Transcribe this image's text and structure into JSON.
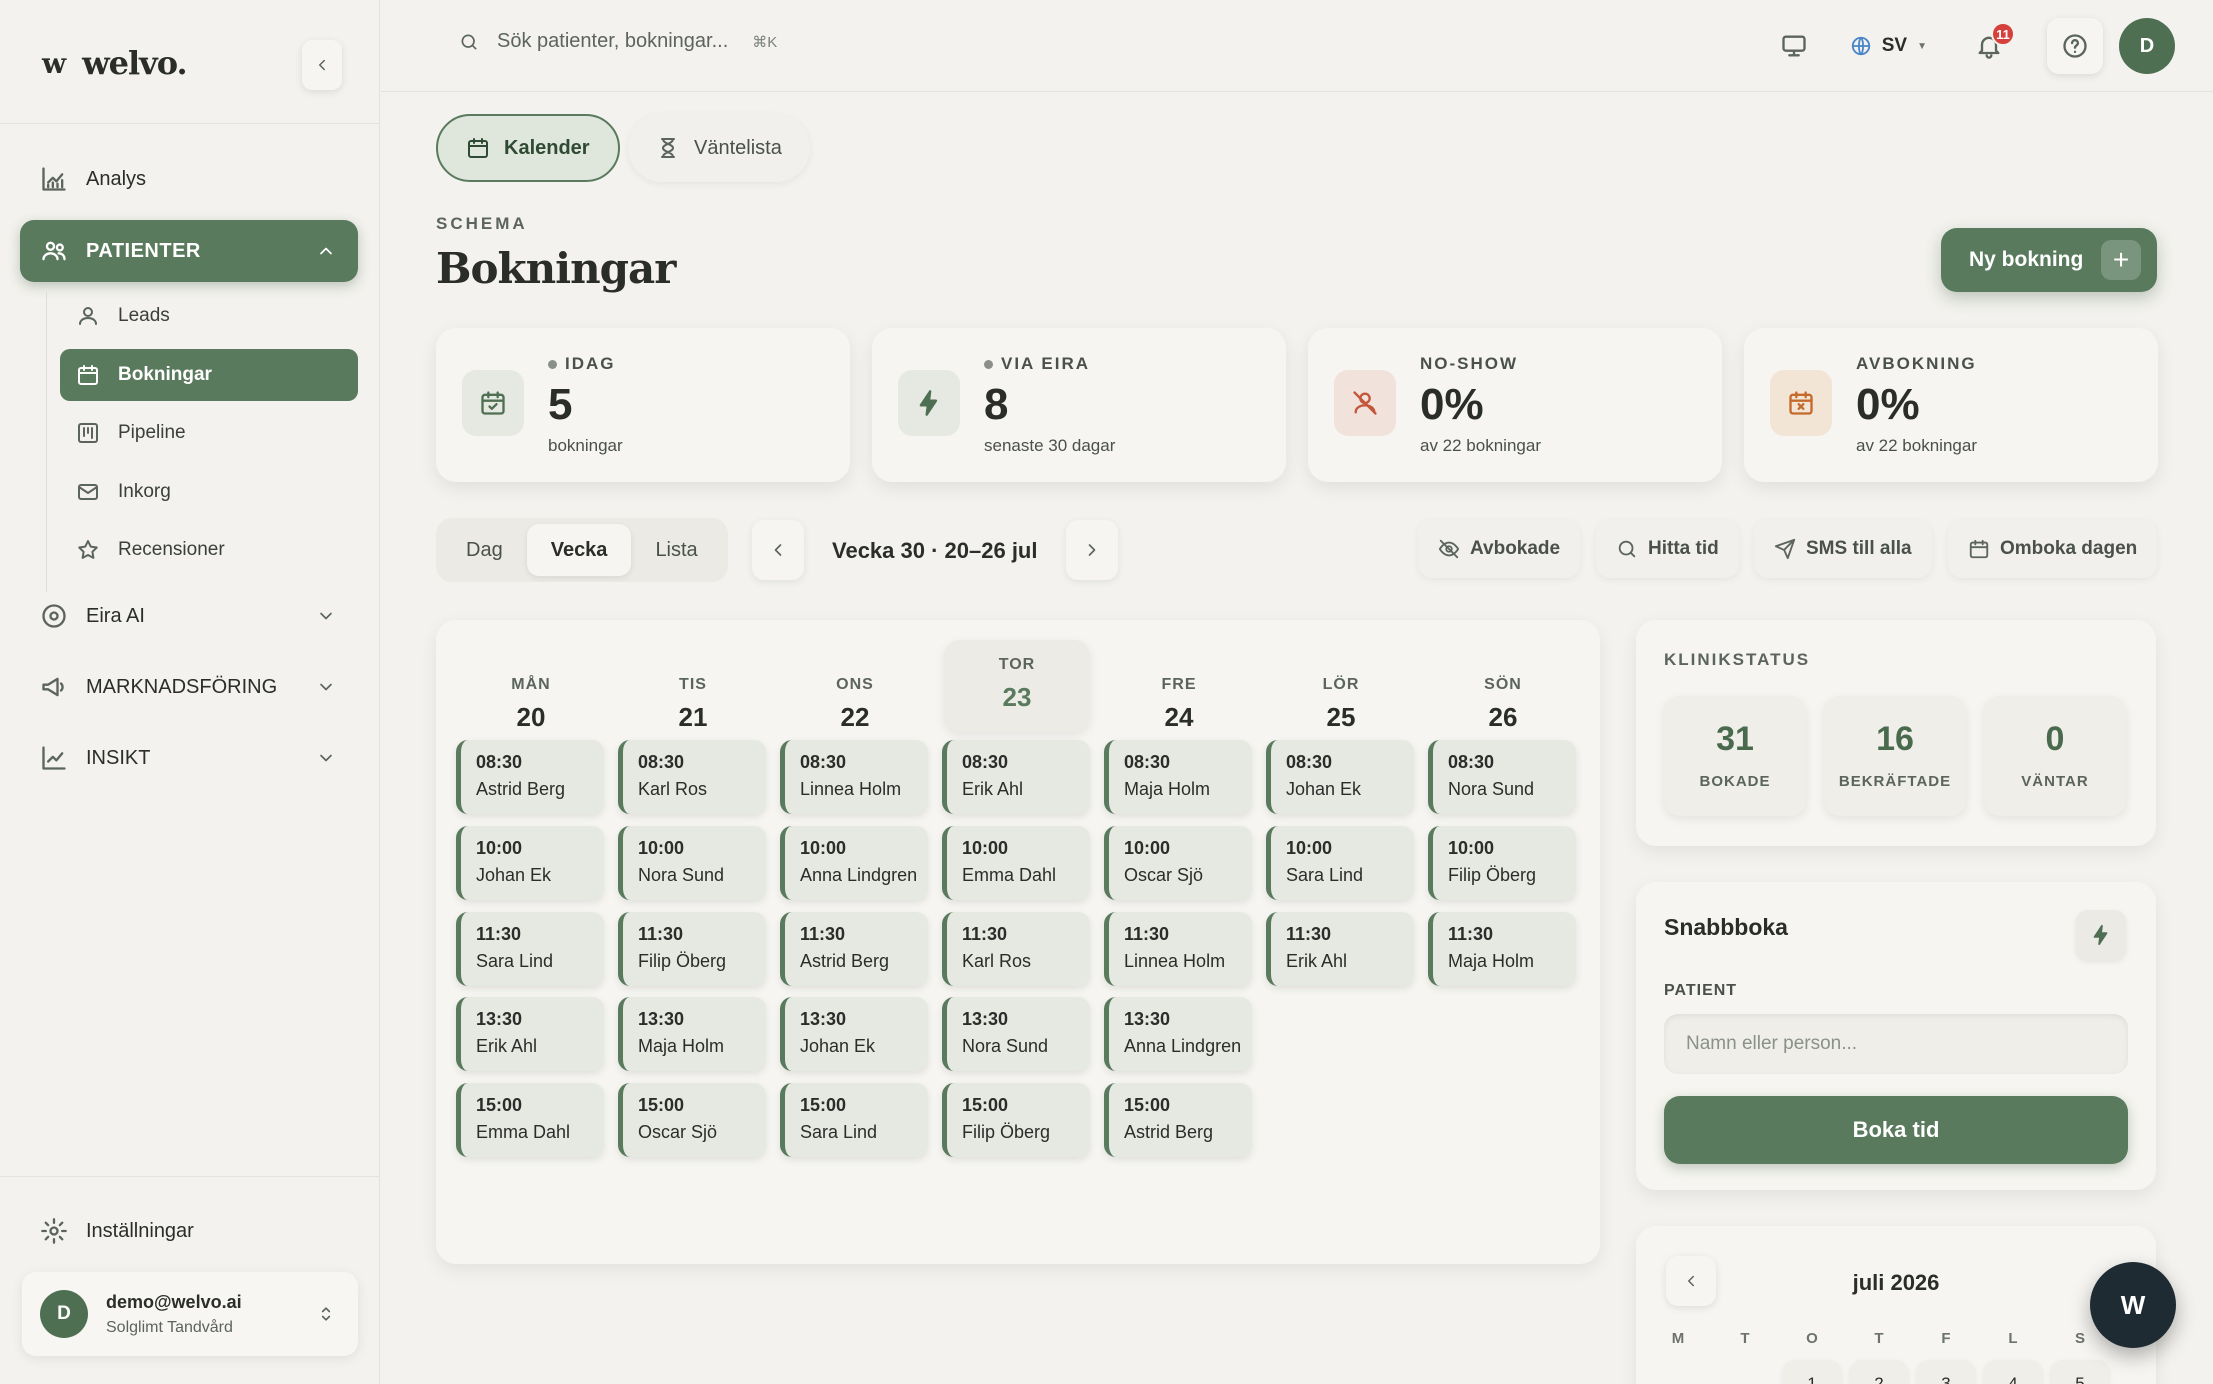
{
  "brand": {
    "mark": "w",
    "name": "welvo."
  },
  "sidebar": {
    "analys": "Analys",
    "patienter": "PATIENTER",
    "sub": [
      "Leads",
      "Bokningar",
      "Pipeline",
      "Inkorg",
      "Recensioner"
    ],
    "eira": "Eira AI",
    "marknad": "MARKNADSFÖRING",
    "insikt": "INSIKT",
    "settings": "Inställningar",
    "user": {
      "initial": "D",
      "email": "demo@welvo.ai",
      "clinic": "Solglimt Tandvård"
    }
  },
  "topbar": {
    "search_placeholder": "Sök patienter, bokningar...",
    "shortcut": "⌘K",
    "lang": "SV",
    "notif_count": "11",
    "avatar": "D"
  },
  "tabs": {
    "kalender": "Kalender",
    "vantelista": "Väntelista"
  },
  "header": {
    "eyebrow": "SCHEMA",
    "title": "Bokningar",
    "new_booking": "Ny bokning",
    "plus": "+"
  },
  "stats": [
    {
      "label": "IDAG",
      "value": "5",
      "sub": "bokningar"
    },
    {
      "label": "VIA EIRA",
      "value": "8",
      "sub": "senaste 30 dagar"
    },
    {
      "label": "NO-SHOW",
      "value": "0%",
      "sub": "av 22 bokningar"
    },
    {
      "label": "AVBOKNING",
      "value": "0%",
      "sub": "av 22 bokningar"
    }
  ],
  "toolbar": {
    "views": [
      "Dag",
      "Vecka",
      "Lista"
    ],
    "week": "Vecka 30 · 20–26 jul",
    "avbokade": "Avbokade",
    "hitta": "Hitta tid",
    "sms": "SMS till alla",
    "omboka": "Omboka dagen"
  },
  "days": [
    {
      "name": "MÅN",
      "date": "20",
      "bookings": [
        {
          "time": "08:30",
          "name": "Astrid Berg"
        },
        {
          "time": "10:00",
          "name": "Johan Ek"
        },
        {
          "time": "11:30",
          "name": "Sara Lind"
        },
        {
          "time": "13:30",
          "name": "Erik Ahl"
        },
        {
          "time": "15:00",
          "name": "Emma Dahl"
        }
      ]
    },
    {
      "name": "TIS",
      "date": "21",
      "bookings": [
        {
          "time": "08:30",
          "name": "Karl Ros"
        },
        {
          "time": "10:00",
          "name": "Nora Sund"
        },
        {
          "time": "11:30",
          "name": "Filip Öberg"
        },
        {
          "time": "13:30",
          "name": "Maja Holm"
        },
        {
          "time": "15:00",
          "name": "Oscar Sjö"
        }
      ]
    },
    {
      "name": "ONS",
      "date": "22",
      "bookings": [
        {
          "time": "08:30",
          "name": "Linnea Holm"
        },
        {
          "time": "10:00",
          "name": "Anna Lindgren"
        },
        {
          "time": "11:30",
          "name": "Astrid Berg"
        },
        {
          "time": "13:30",
          "name": "Johan Ek"
        },
        {
          "time": "15:00",
          "name": "Sara Lind"
        }
      ]
    },
    {
      "name": "TOR",
      "date": "23",
      "today": true,
      "bookings": [
        {
          "time": "08:30",
          "name": "Erik Ahl"
        },
        {
          "time": "10:00",
          "name": "Emma Dahl"
        },
        {
          "time": "11:30",
          "name": "Karl Ros"
        },
        {
          "time": "13:30",
          "name": "Nora Sund"
        },
        {
          "time": "15:00",
          "name": "Filip Öberg"
        }
      ]
    },
    {
      "name": "FRE",
      "date": "24",
      "bookings": [
        {
          "time": "08:30",
          "name": "Maja Holm"
        },
        {
          "time": "10:00",
          "name": "Oscar Sjö"
        },
        {
          "time": "11:30",
          "name": "Linnea Holm"
        },
        {
          "time": "13:30",
          "name": "Anna Lindgren"
        },
        {
          "time": "15:00",
          "name": "Astrid Berg"
        }
      ]
    },
    {
      "name": "LÖR",
      "date": "25",
      "bookings": [
        {
          "time": "08:30",
          "name": "Johan Ek"
        },
        {
          "time": "10:00",
          "name": "Sara Lind"
        },
        {
          "time": "11:30",
          "name": "Erik Ahl"
        }
      ]
    },
    {
      "name": "SÖN",
      "date": "26",
      "bookings": [
        {
          "time": "08:30",
          "name": "Nora Sund"
        },
        {
          "time": "10:00",
          "name": "Filip Öberg"
        },
        {
          "time": "11:30",
          "name": "Maja Holm"
        }
      ]
    }
  ],
  "klinik": {
    "title": "KLINIKSTATUS",
    "items": [
      {
        "value": "31",
        "label": "BOKADE"
      },
      {
        "value": "16",
        "label": "BEKRÄFTADE"
      },
      {
        "value": "0",
        "label": "VÄNTAR"
      }
    ]
  },
  "snabb": {
    "title": "Snabbboka",
    "patient_label": "PATIENT",
    "placeholder": "Namn eller person...",
    "button": "Boka tid"
  },
  "minical": {
    "month": "juli 2026",
    "weekdays": [
      "M",
      "T",
      "O",
      "T",
      "F",
      "L",
      "S"
    ],
    "days": [
      "1",
      "2",
      "3",
      "4",
      "5"
    ]
  },
  "fab": "W",
  "colors": {
    "accent": "#5a7a5e",
    "background": "#f3f2ee",
    "alert": "#d6403a"
  }
}
